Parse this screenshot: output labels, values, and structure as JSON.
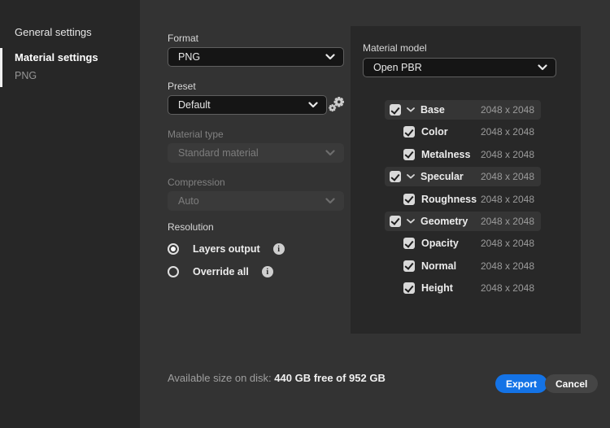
{
  "sidebar": {
    "items": [
      {
        "label": "General settings",
        "active": false
      },
      {
        "label": "Material settings",
        "active": true
      },
      {
        "label": "PNG",
        "active": false,
        "child_of": "Material settings"
      }
    ]
  },
  "form": {
    "format": {
      "label": "Format",
      "value": "PNG",
      "disabled": false
    },
    "preset": {
      "label": "Preset",
      "value": "Default",
      "disabled": false
    },
    "material_type": {
      "label": "Material type",
      "value": "Standard material",
      "disabled": true
    },
    "compression": {
      "label": "Compression",
      "value": "Auto",
      "disabled": true
    },
    "resolution": {
      "label": "Resolution",
      "options": [
        {
          "label": "Layers output",
          "selected": true,
          "has_info": true
        },
        {
          "label": "Override all",
          "selected": false,
          "has_info": true
        }
      ]
    }
  },
  "panel": {
    "material_model": {
      "label": "Material model",
      "value": "Open PBR"
    },
    "maps": [
      {
        "label": "Base",
        "resolution": "2048 x 2048",
        "parent": true,
        "expanded": true,
        "checked": true
      },
      {
        "label": "Color",
        "resolution": "2048 x 2048",
        "parent": false,
        "checked": true
      },
      {
        "label": "Metalness",
        "resolution": "2048 x 2048",
        "parent": false,
        "checked": true
      },
      {
        "label": "Specular",
        "resolution": "2048 x 2048",
        "parent": true,
        "expanded": true,
        "checked": true
      },
      {
        "label": "Roughness",
        "resolution": "2048 x 2048",
        "parent": false,
        "checked": true
      },
      {
        "label": "Geometry",
        "resolution": "2048 x 2048",
        "parent": true,
        "expanded": true,
        "checked": true
      },
      {
        "label": "Opacity",
        "resolution": "2048 x 2048",
        "parent": false,
        "checked": true
      },
      {
        "label": "Normal",
        "resolution": "2048 x 2048",
        "parent": false,
        "checked": true
      },
      {
        "label": "Height",
        "resolution": "2048 x 2048",
        "parent": false,
        "checked": true
      }
    ]
  },
  "footer": {
    "disk_label": "Available size on disk:",
    "disk_value": "440 GB free of 952 GB",
    "export_label": "Export",
    "cancel_label": "Cancel"
  },
  "icons": {
    "info_glyph": "i"
  },
  "colors": {
    "accent_blue": "#1473e6",
    "main_bg": "#333333",
    "sidebar_bg": "#272727",
    "panel_bg": "#282828",
    "input_bg": "#151515"
  }
}
